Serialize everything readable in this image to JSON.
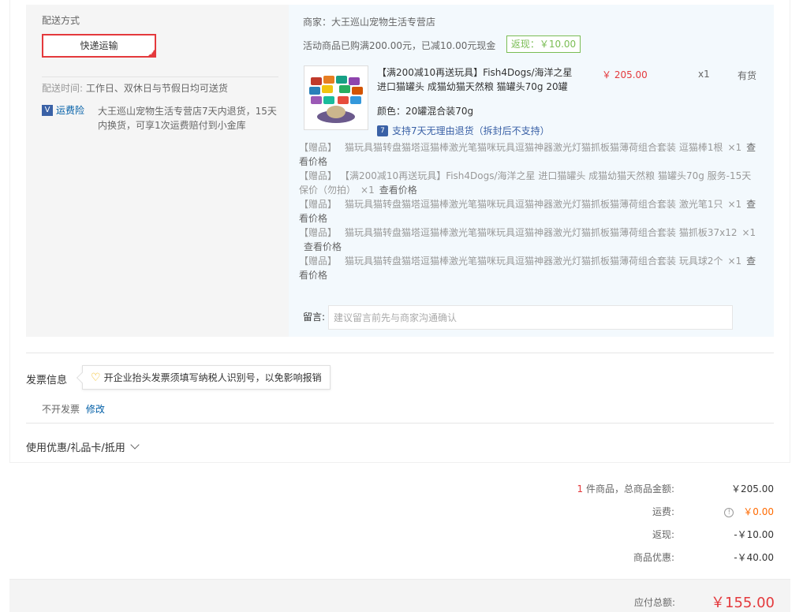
{
  "delivery": {
    "title": "配送方式",
    "method": "快递运输",
    "time_label": "配送时间:",
    "time_value": "工作日、双休日与节假日均可送货",
    "insurance_label": "运费险",
    "insurance_text": "大王巡山宠物生活专营店7天内退货，15天内换货，可享1次运费赔付到小金库"
  },
  "shop": {
    "merchant": "商家：大王巡山宠物生活专营店",
    "promo": "活动商品已购满200.00元，已减10.00元现金",
    "rebate": "返现：￥10.00",
    "product": {
      "name": "【满200减10再送玩具】Fish4Dogs/海洋之星 进口猫罐头 成猫幼猫天然粮 猫罐头70g 20罐",
      "price": "￥ 205.00",
      "qty": "x1",
      "stock": "有货",
      "color": "颜色：20罐混合装70g",
      "service": "支持7天无理由退货（拆封后不支持）"
    },
    "gifts": [
      {
        "tag": "【赠品】",
        "name": "猫玩具猫转盘猫塔逗猫棒激光笔猫咪玩具逗猫神器激光灯猫抓板猫薄荷组合套装 逗猫棒1根",
        "qty": "×1",
        "view": "查看价格"
      },
      {
        "tag": "【赠品】",
        "name": "【满200减10再送玩具】Fish4Dogs/海洋之星 进口猫罐头 成猫幼猫天然粮 猫罐头70g 服务-15天保价（勿拍）",
        "qty": "×1",
        "view": "查看价格"
      },
      {
        "tag": "【赠品】",
        "name": "猫玩具猫转盘猫塔逗猫棒激光笔猫咪玩具逗猫神器激光灯猫抓板猫薄荷组合套装 激光笔1只",
        "qty": "×1",
        "view": "查看价格"
      },
      {
        "tag": "【赠品】",
        "name": "猫玩具猫转盘猫塔逗猫棒激光笔猫咪玩具逗猫神器激光灯猫抓板猫薄荷组合套装 猫抓板37x12",
        "qty": "×1",
        "view": "查看价格"
      },
      {
        "tag": "【赠品】",
        "name": "猫玩具猫转盘猫塔逗猫棒激光笔猫咪玩具逗猫神器激光灯猫抓板猫薄荷组合套装 玩具球2个",
        "qty": "×1",
        "view": "查看价格"
      }
    ],
    "message_label": "留言:",
    "message_placeholder": "建议留言前先与商家沟通确认"
  },
  "invoice": {
    "title": "发票信息",
    "tip": "开企业抬头发票须填写纳税人识别号，以免影响报销",
    "status": "不开发票",
    "edit": "修改"
  },
  "coupon": {
    "label": "使用优惠/礼品卡/抵用"
  },
  "summary": {
    "count": "1",
    "count_label": "件商品，总商品金额:",
    "goods_total": "￥205.00",
    "shipping_label": "运费:",
    "shipping": "￥0.00",
    "rebate_label": "返现:",
    "rebate": "-￥10.00",
    "discount_label": "商品优惠:",
    "discount": "-￥40.00",
    "payable_label": "应付总额:",
    "payable": "￥155.00"
  },
  "colors": {
    "accent": "#e4393c",
    "link": "#005ea7",
    "rebate": "#7abd54",
    "shipping": "#ff6a00"
  }
}
